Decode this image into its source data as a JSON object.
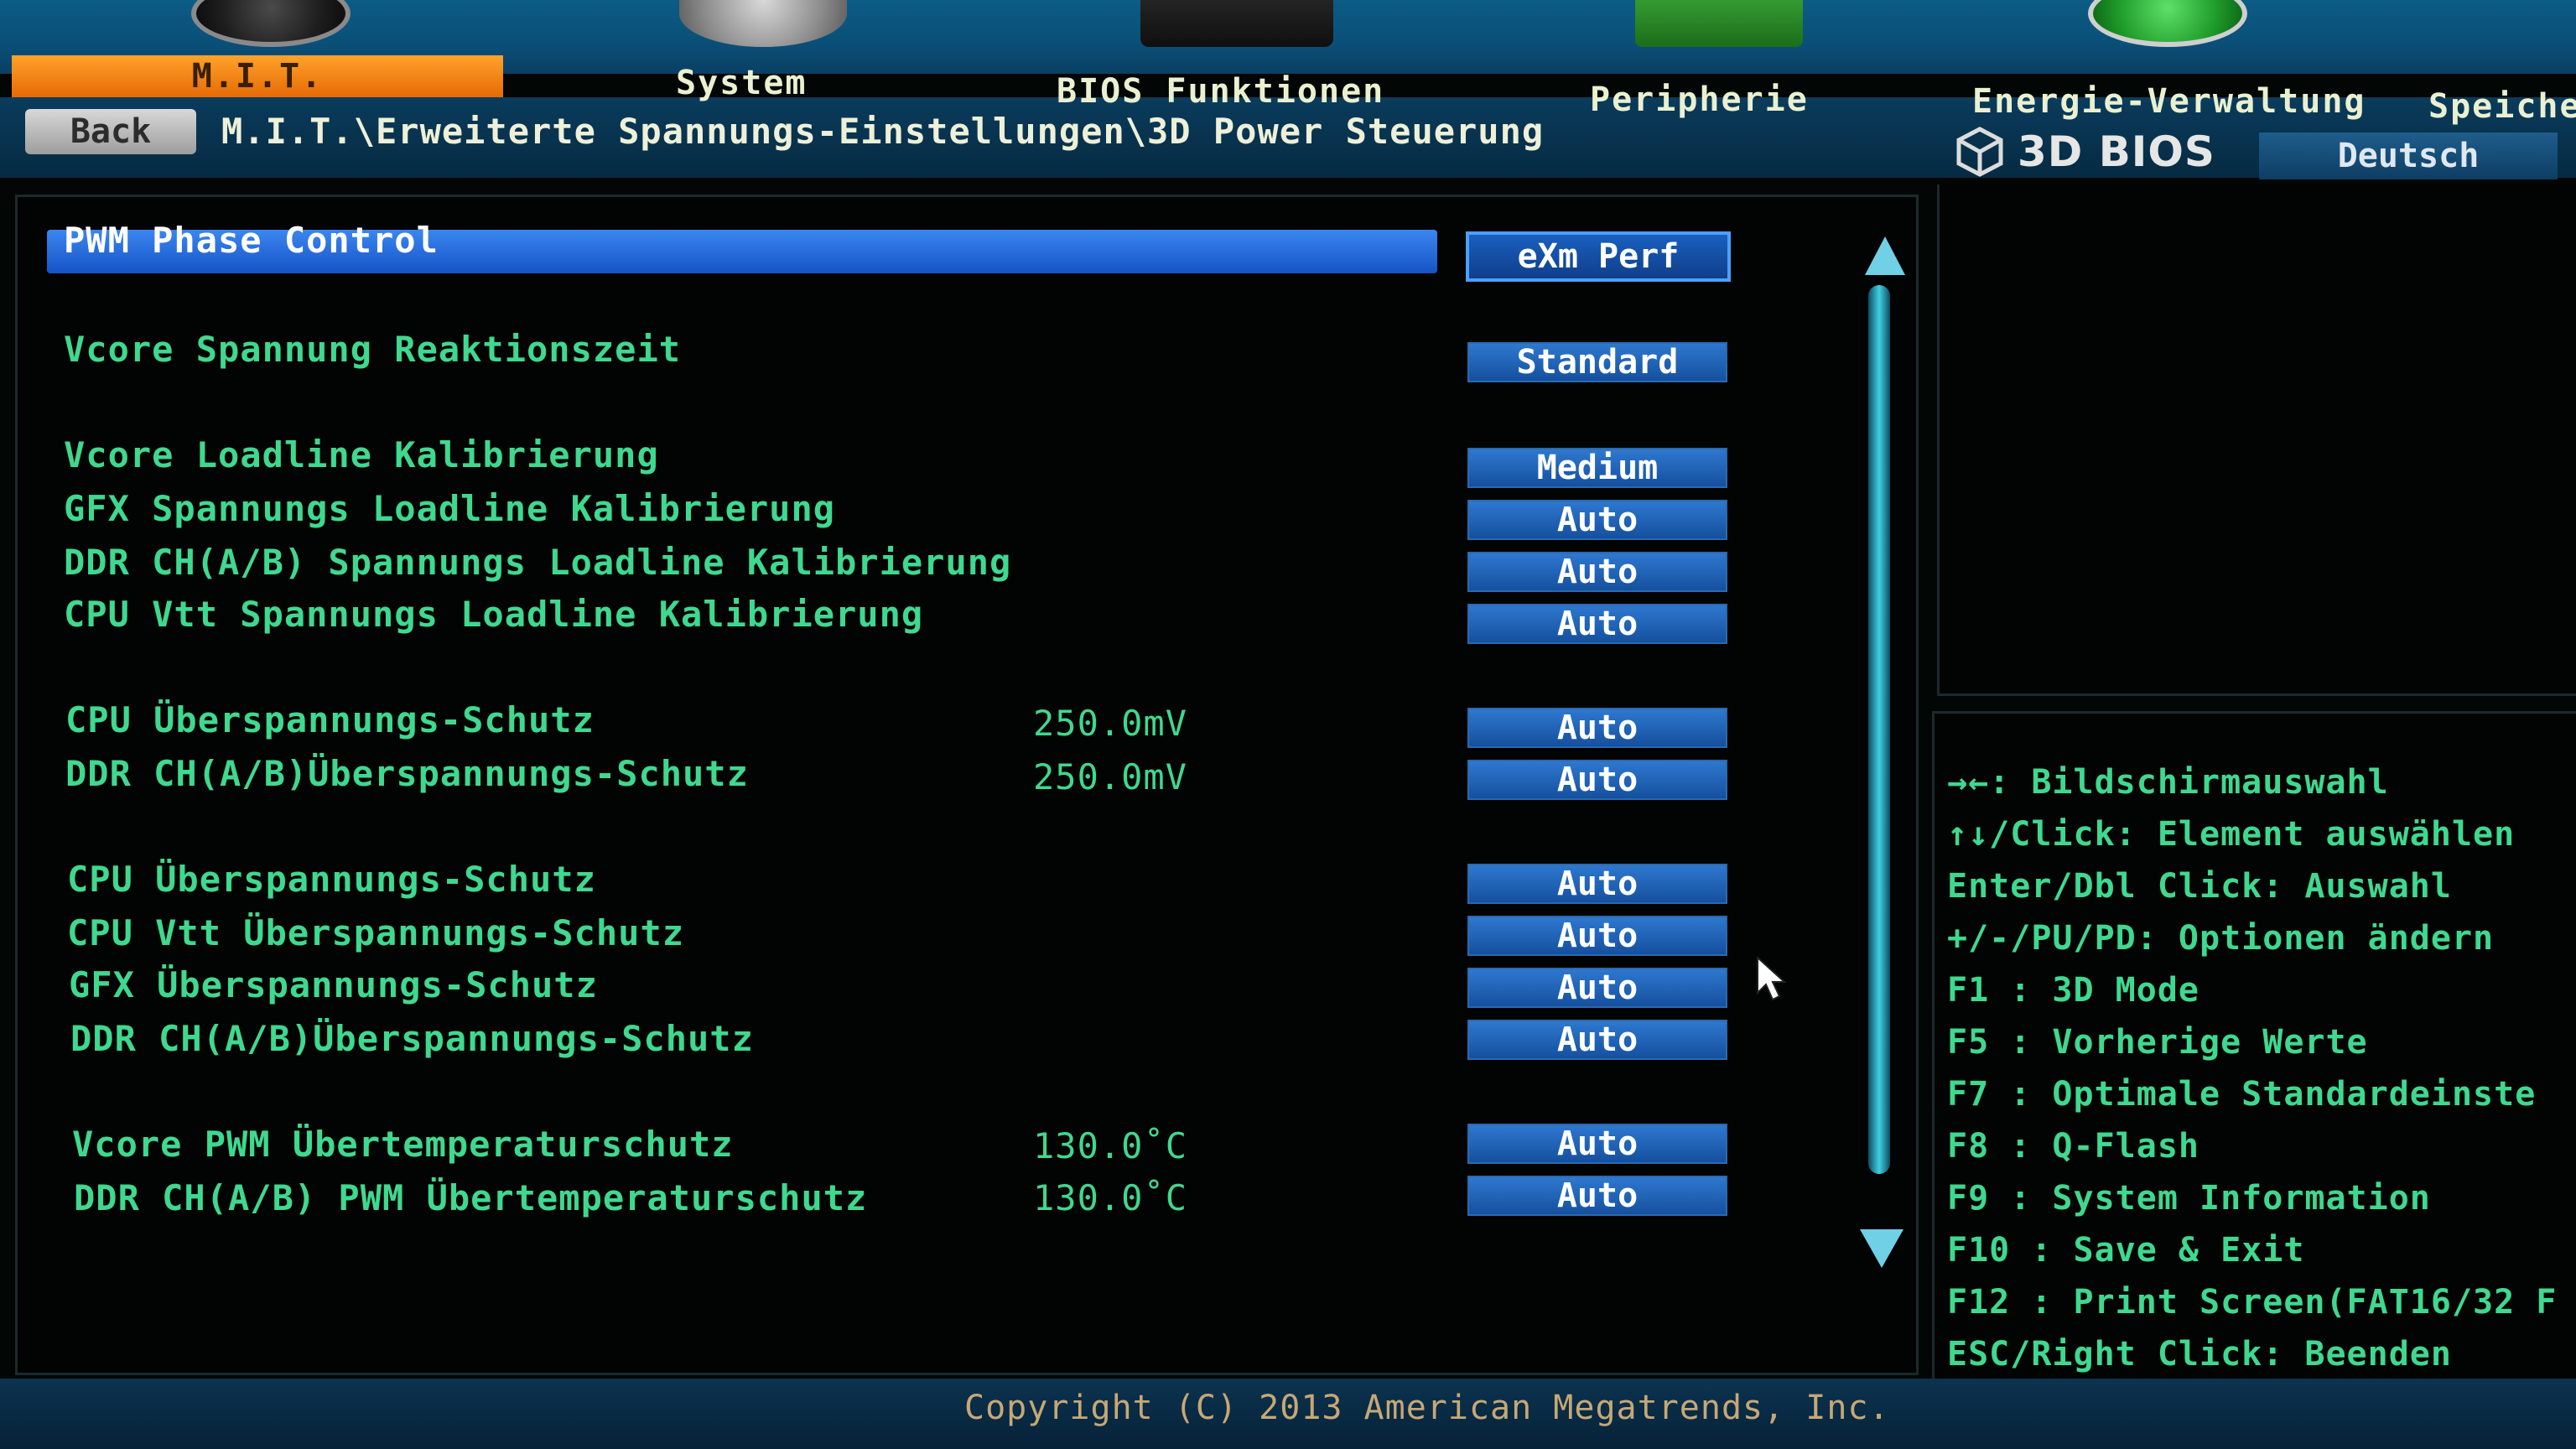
{
  "tabs": {
    "mit": "M.I.T.",
    "system": "System",
    "bios": "BIOS Funktionen",
    "periph": "Peripherie",
    "energie": "Energie-Verwaltung",
    "speicher": "Speiche"
  },
  "nav": {
    "back_label": "Back",
    "breadcrumb": "M.I.T.\\Erweiterte Spannungs-Einstellungen\\3D Power Steuerung"
  },
  "brand": {
    "logo_text": "3D BIOS",
    "language": "Deutsch"
  },
  "settings": [
    {
      "label": "PWM Phase Control",
      "reading": "",
      "value": "eXm Perf",
      "selected": true
    },
    {
      "label": "Vcore Spannung Reaktionszeit",
      "reading": "",
      "value": "Standard"
    },
    {
      "label": "Vcore Loadline Kalibrierung",
      "reading": "",
      "value": "Medium"
    },
    {
      "label": "GFX Spannungs Loadline Kalibrierung",
      "reading": "",
      "value": "Auto"
    },
    {
      "label": "DDR CH(A/B) Spannungs Loadline Kalibrierung",
      "reading": "",
      "value": "Auto"
    },
    {
      "label": "CPU Vtt Spannungs Loadline Kalibrierung",
      "reading": "",
      "value": "Auto"
    },
    {
      "label": "CPU Überspannungs-Schutz",
      "reading": "250.0mV",
      "value": "Auto"
    },
    {
      "label": "DDR CH(A/B)Überspannungs-Schutz",
      "reading": "250.0mV",
      "value": "Auto"
    },
    {
      "label": "CPU Überspannungs-Schutz",
      "reading": "",
      "value": "Auto"
    },
    {
      "label": "CPU Vtt Überspannungs-Schutz",
      "reading": "",
      "value": "Auto"
    },
    {
      "label": "GFX Überspannungs-Schutz",
      "reading": "",
      "value": "Auto"
    },
    {
      "label": "DDR CH(A/B)Überspannungs-Schutz",
      "reading": "",
      "value": "Auto"
    },
    {
      "label": "Vcore PWM Übertemperaturschutz",
      "reading": "130.0˚C",
      "value": "Auto"
    },
    {
      "label": "DDR CH(A/B) PWM Übertemperaturschutz",
      "reading": "130.0˚C",
      "value": "Auto"
    }
  ],
  "help": [
    "→←: Bildschirmauswahl",
    "↑↓/Click: Element auswählen",
    "Enter/Dbl Click: Auswahl",
    "+/-/PU/PD: Optionen ändern",
    "F1  : 3D Mode",
    "F5  : Vorherige Werte",
    "F7  : Optimale Standardeinste",
    "F8  : Q-Flash",
    "F9  : System Information",
    "F10 : Save & Exit",
    "F12 : Print Screen(FAT16/32 F",
    "ESC/Right Click: Beenden"
  ],
  "footer": {
    "copyright": "Copyright (C) 2013 American Megatrends, Inc."
  },
  "colors": {
    "accent_orange": "#e66a06",
    "text_green": "#3fd88f",
    "value_blue": "#1654c6",
    "background": "#020604"
  },
  "icons": {
    "mit": "gauge-icon",
    "system": "gear-icon",
    "bios": "chip-icon",
    "periph": "peripheral-icon",
    "energie": "power-icon"
  }
}
